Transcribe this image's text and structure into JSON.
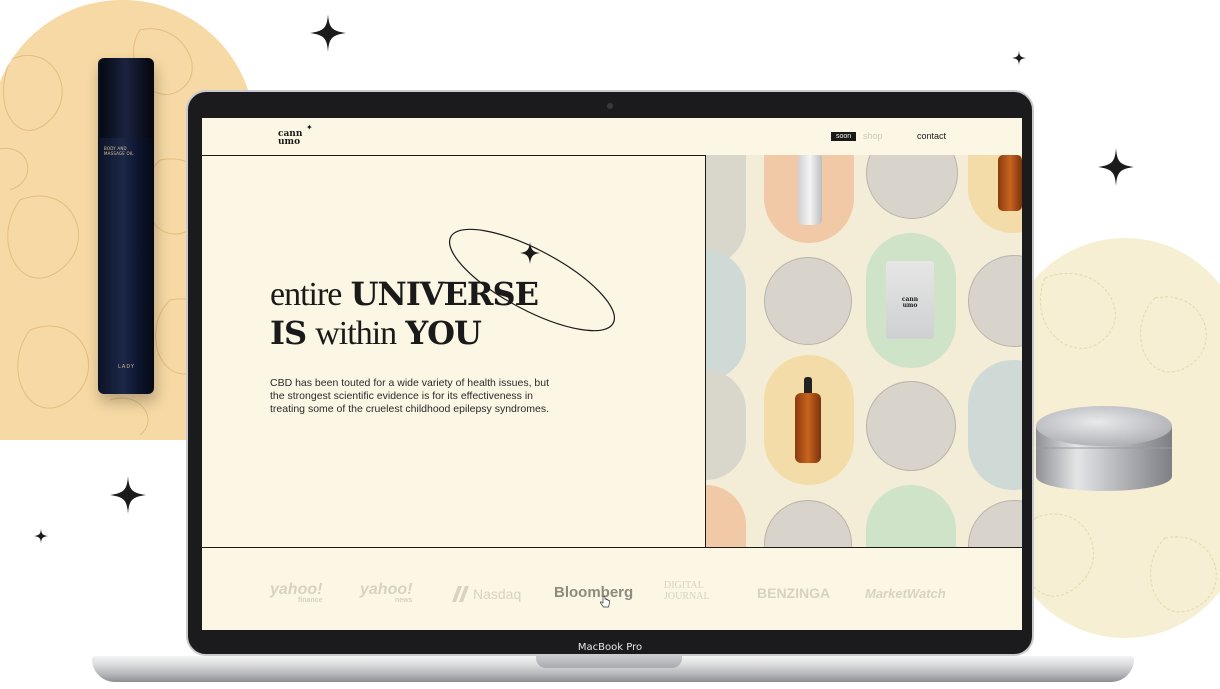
{
  "site": {
    "logo_line1": "cann",
    "logo_line2": "umo",
    "nav": {
      "soon_badge": "soon",
      "shop": "shop",
      "contact": "contact"
    },
    "hero": {
      "line1_light": "entire",
      "line1_bold": "UNIVERSE",
      "line2_bold_a": "IS",
      "line2_light": "within",
      "line2_bold_b": "YOU",
      "body": "CBD has been touted for a wide variety of health issues, but the strongest scientific evidence is for its effectiveness in treating some of the cruelest childhood epilepsy syndromes."
    },
    "press_logos": [
      {
        "line1": "yahoo!",
        "line2": "finance"
      },
      {
        "line1": "yahoo!",
        "line2": "news"
      },
      {
        "line1": "Nasdaq"
      },
      {
        "line1": "Bloomberg"
      },
      {
        "line1": "DIGITAL",
        "line2": "JOURNAL"
      },
      {
        "line1": "BENZINGA"
      },
      {
        "line1": "MarketWatch"
      }
    ],
    "product_labels": {
      "pouch_line1": "cann",
      "pouch_line2": "umo"
    }
  },
  "device": {
    "label": "MacBook Pro"
  },
  "bottle": {
    "text": "BODY AND MASSAGE OIL",
    "brand": "LADY"
  },
  "colors": {
    "screen_bg": "#fcf6e4",
    "ink": "#1a1a1a",
    "peach_blob": "#f6d9a4",
    "cream_blob": "#f7efd3",
    "pill_orange": "#f1c9a6",
    "pill_green": "#cfe3c8",
    "pill_blue": "#cfd9d6",
    "pill_yellow": "#f3dca7"
  }
}
